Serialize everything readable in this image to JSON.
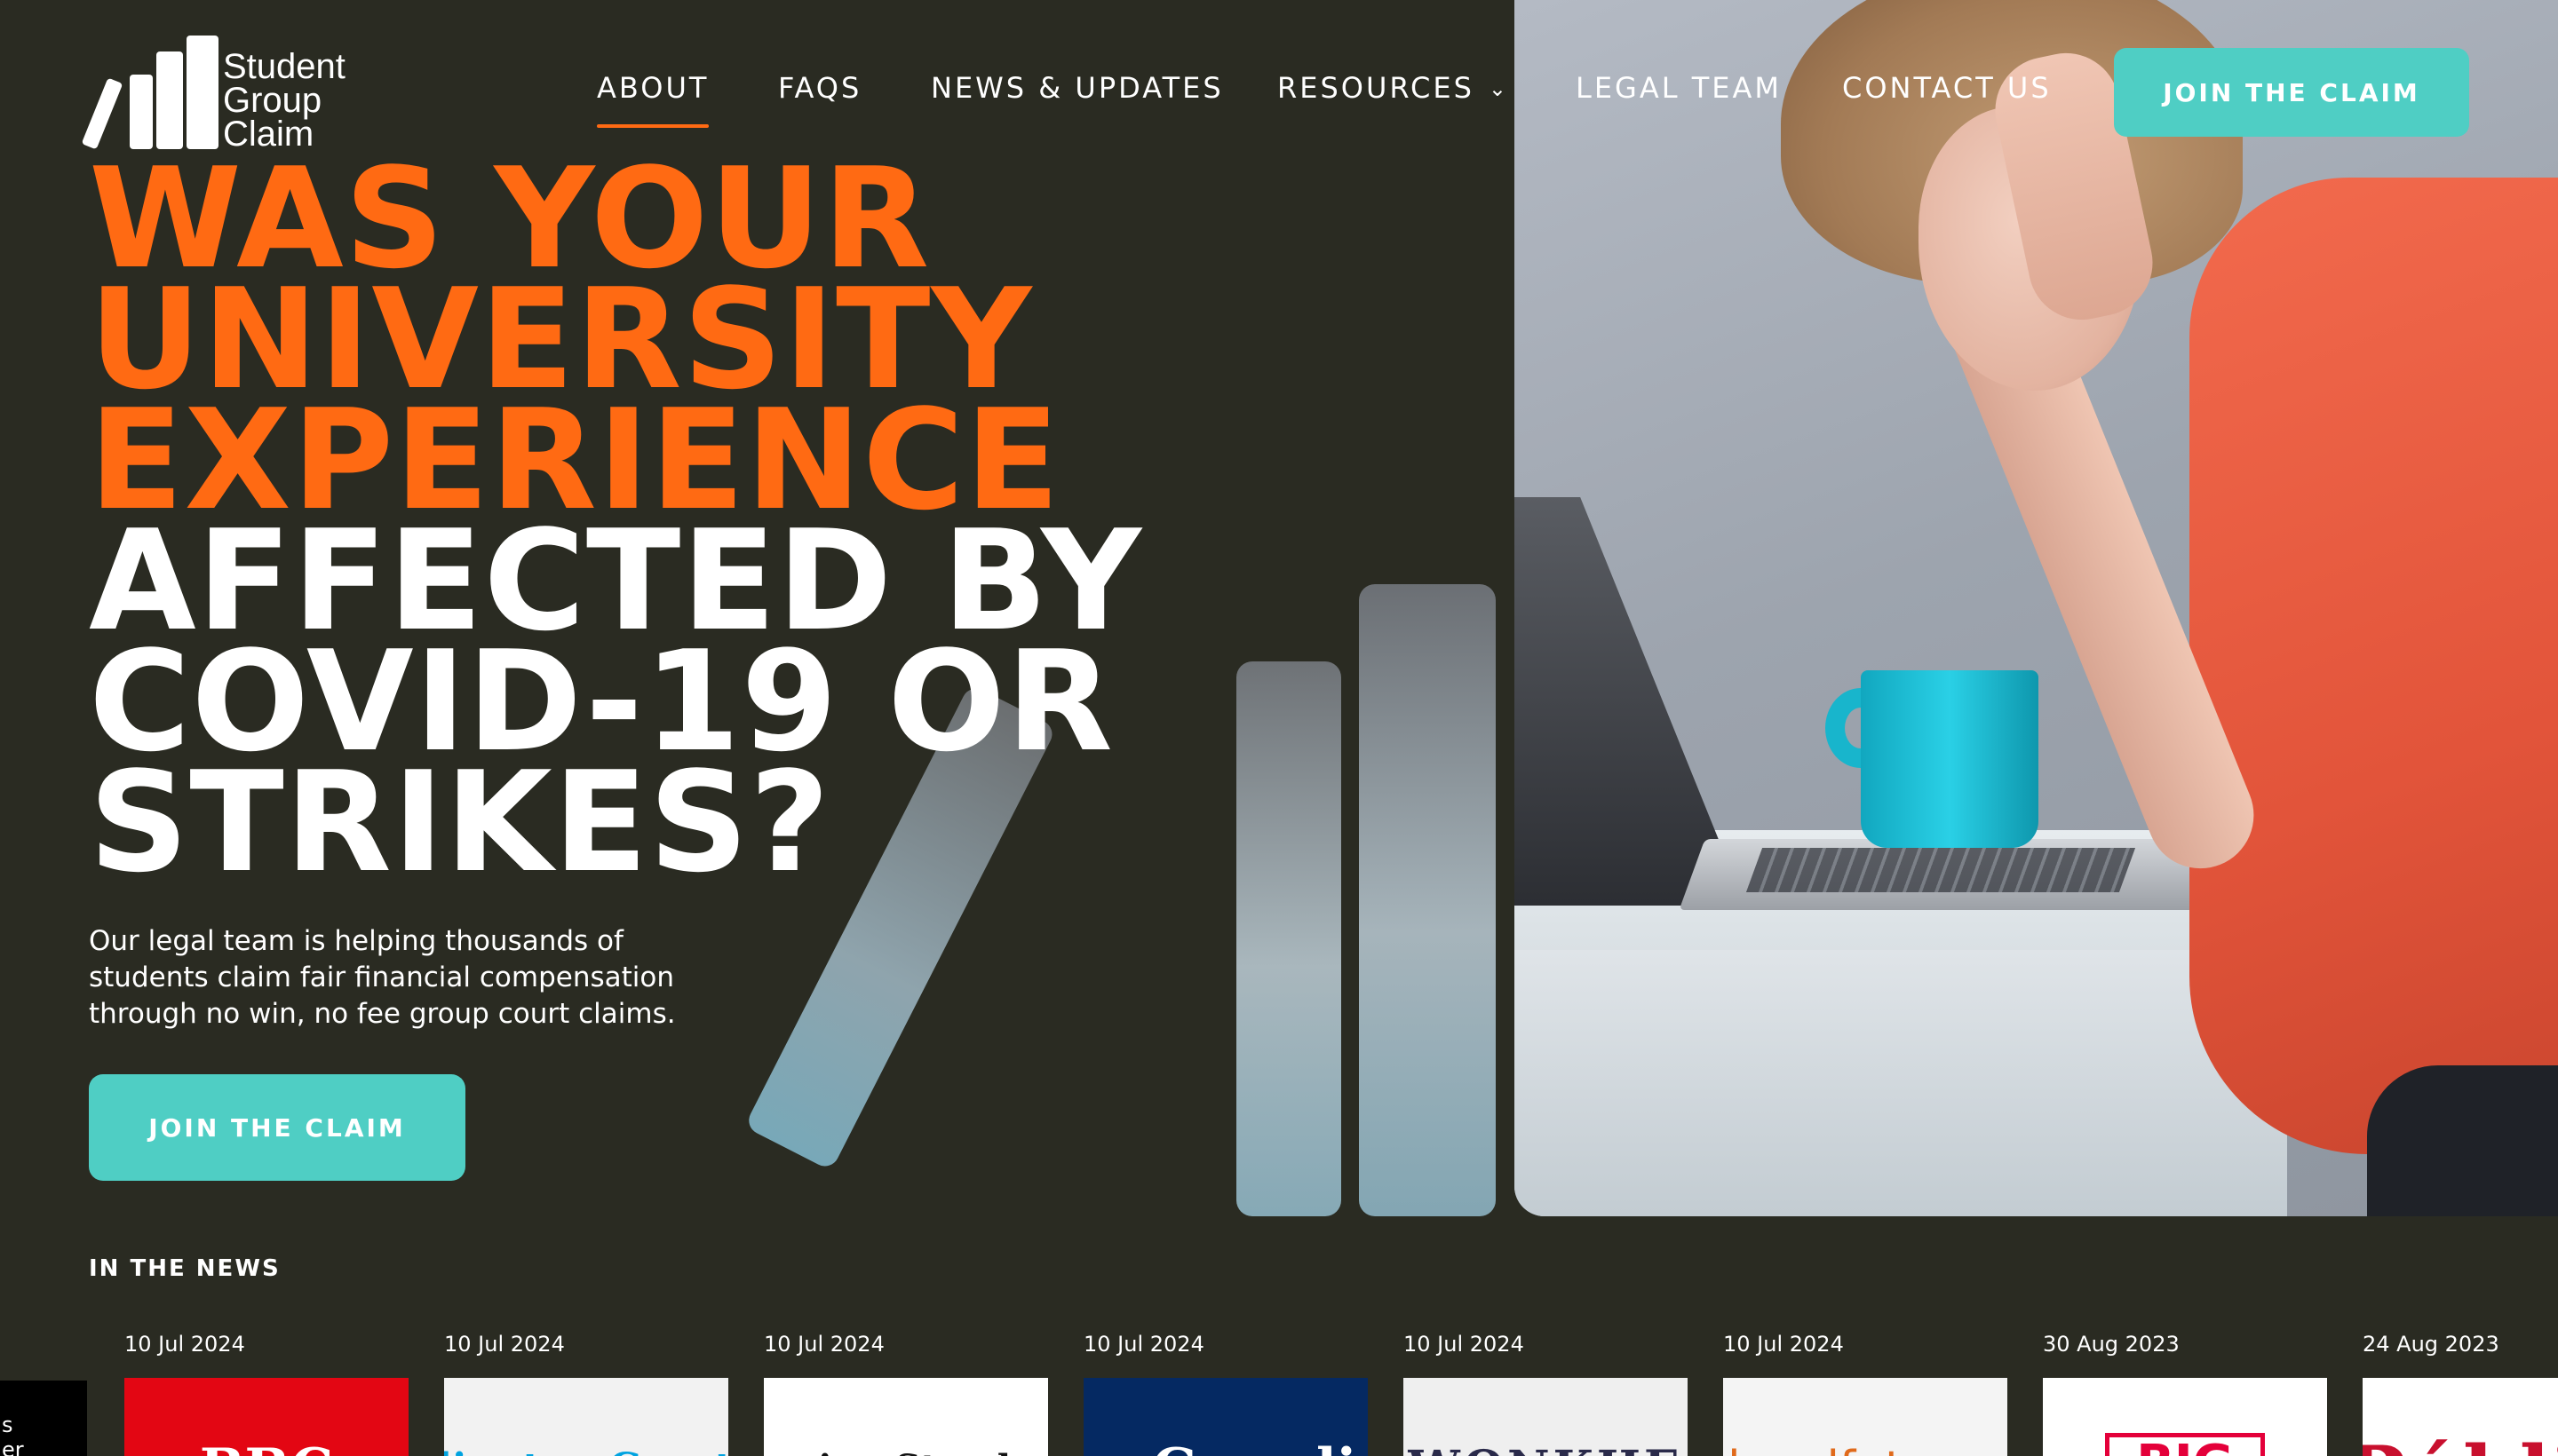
{
  "brand": {
    "logo_line1": "Student",
    "logo_line2": "Group",
    "logo_line3": "Claim"
  },
  "nav": {
    "items": [
      {
        "label": "ABOUT",
        "active": true
      },
      {
        "label": "FAQS",
        "active": false
      },
      {
        "label": "NEWS & UPDATES",
        "active": false
      },
      {
        "label": "RESOURCES",
        "active": false,
        "has_dropdown": true
      },
      {
        "label": "LEGAL TEAM",
        "active": false
      },
      {
        "label": "CONTACT US",
        "active": false
      }
    ],
    "cta_label": "JOIN THE CLAIM"
  },
  "hero": {
    "headline_orange": [
      "WAS YOUR",
      "UNIVERSITY",
      "EXPERIENCE"
    ],
    "headline_white": [
      "AFFECTED BY",
      "COVID-19 OR",
      "STRIKES?"
    ],
    "subtext": "Our legal team is helping thousands of students claim fair financial compensation through no win, no fee group court claims.",
    "cta_label": "JOIN THE CLAIM"
  },
  "news": {
    "heading": "IN THE NEWS",
    "partial_left_text": "s\ner",
    "items": [
      {
        "date": "10 Jul 2024",
        "brand": "BBC",
        "bg": "#e30613",
        "fg": "#ffffff",
        "icon": "bbc-logo"
      },
      {
        "date": "10 Jul 2024",
        "brand": "Islington Gazette",
        "bg": "#f2f2f2",
        "fg": "#00a3e0",
        "icon": "islington-gazette-logo"
      },
      {
        "date": "10 Jul 2024",
        "brand": "Evening Standard.",
        "bg": "#ffffff",
        "fg": "#111111",
        "icon": "evening-standard-logo"
      },
      {
        "date": "10 Jul 2024",
        "brand": "The Guardian",
        "bg": "#052962",
        "fg": "#ffffff",
        "icon": "guardian-logo"
      },
      {
        "date": "10 Jul 2024",
        "brand": "WONKHE",
        "bg": "#efefef",
        "fg": "#2a2a4a",
        "icon": "wonkhe-logo"
      },
      {
        "date": "10 Jul 2024",
        "brand": "legalfutures",
        "bg": "#f4f4f4",
        "fg": "#e06a1b",
        "icon": "legalfutures-logo"
      },
      {
        "date": "30 Aug 2023",
        "brand": "BIG",
        "bg": "#ffffff",
        "fg": "#e4003a",
        "icon": "big-issue-logo"
      },
      {
        "date": "24 Aug 2023",
        "brand": "Público",
        "bg": "#ffffff",
        "fg": "#c8102e",
        "icon": "publico-logo"
      }
    ]
  },
  "colors": {
    "background": "#2a2b22",
    "accent_orange": "#ff6a13",
    "accent_teal": "#4fcec4"
  }
}
